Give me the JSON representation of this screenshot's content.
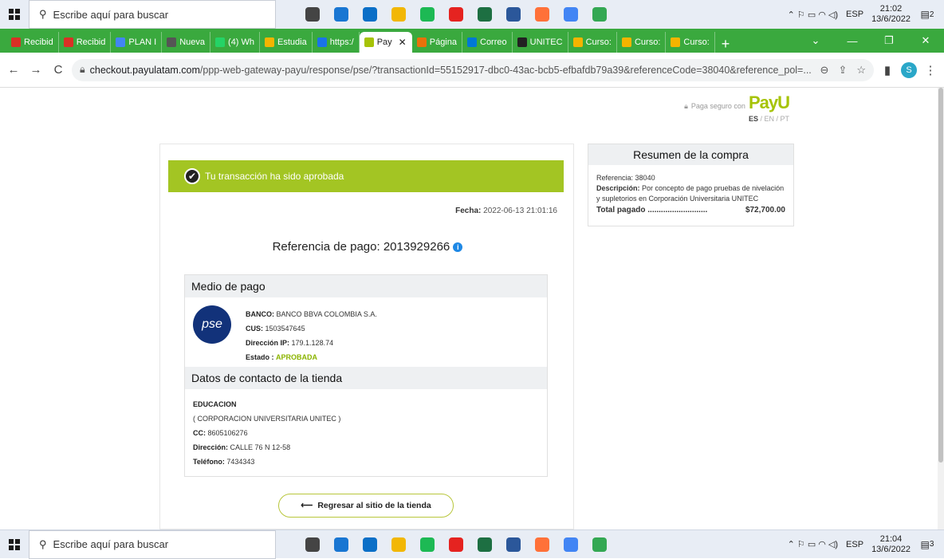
{
  "taskbar": {
    "search_placeholder": "Escribe aquí para buscar",
    "lang": "ESP",
    "top_time": "21:02",
    "top_date": "13/6/2022",
    "top_notif": "2",
    "bottom_time": "21:04",
    "bottom_date": "13/6/2022",
    "bottom_notif": "3",
    "apps": [
      {
        "name": "task-view",
        "color": "#444"
      },
      {
        "name": "edge",
        "color": "#1976d2"
      },
      {
        "name": "mail",
        "color": "#0b6fc7"
      },
      {
        "name": "file-explorer",
        "color": "#f2b705"
      },
      {
        "name": "spotify",
        "color": "#1db954"
      },
      {
        "name": "acrobat",
        "color": "#e52320"
      },
      {
        "name": "excel",
        "color": "#1d6f42"
      },
      {
        "name": "word",
        "color": "#2b579a"
      },
      {
        "name": "firefox",
        "color": "#ff7139"
      },
      {
        "name": "chrome",
        "color": "#4285f4"
      },
      {
        "name": "chrome-alt",
        "color": "#34a853"
      }
    ]
  },
  "tabs": [
    {
      "label": "Recibid",
      "color": "#d93025"
    },
    {
      "label": "Recibid",
      "color": "#d93025"
    },
    {
      "label": "PLAN I",
      "color": "#4285f4"
    },
    {
      "label": "Nueva",
      "color": "#555"
    },
    {
      "label": "(4) Wh",
      "color": "#25d366"
    },
    {
      "label": "Estudia",
      "color": "#f4b400"
    },
    {
      "label": "https:/",
      "color": "#1a73e8"
    },
    {
      "label": "Pay",
      "color": "#a6c307",
      "active": true
    },
    {
      "label": "Página",
      "color": "#e8710a"
    },
    {
      "label": "Correo",
      "color": "#0078d4"
    },
    {
      "label": "UNITEC",
      "color": "#222"
    },
    {
      "label": "Curso:",
      "color": "#f4b400"
    },
    {
      "label": "Curso:",
      "color": "#f4b400"
    },
    {
      "label": "Curso:",
      "color": "#f4b400"
    }
  ],
  "address": {
    "domain": "checkout.payulatam.com",
    "path": "/ppp-web-gateway-payu/response/pse/?transactionId=55152917-dbc0-43ac-bcb5-efbafdb79a39&referenceCode=38040&reference_pol=..."
  },
  "profile_initial": "S",
  "brand": {
    "secure_text": "Paga seguro con",
    "logo": "PayU",
    "lang_active": "ES",
    "lang_rest": " / EN / PT"
  },
  "status": {
    "message": "Tu transacción ha sido aprobada",
    "date_label": "Fecha:",
    "date_value": "2022-06-13 21:01:16",
    "reference": "Referencia de pago: 2013929266"
  },
  "payment": {
    "title": "Medio de pago",
    "logo_text": "pse",
    "bank_label": "BANCO:",
    "bank": "BANCO BBVA COLOMBIA S.A.",
    "cus_label": "CUS:",
    "cus": "1503547645",
    "ip_label": "Dirección IP:",
    "ip": "179.1.128.74",
    "state_label": "Estado :",
    "state": "APROBADA"
  },
  "store": {
    "title": "Datos de contacto de la tienda",
    "name": "EDUCACION",
    "org": "( CORPORACION UNIVERSITARIA UNITEC )",
    "cc_label": "CC:",
    "cc": "8605106276",
    "address_label": "Dirección:",
    "address": "CALLE 76 N 12-58",
    "phone_label": "Teléfono:",
    "phone": "7434343"
  },
  "back_button": "Regresar al sitio de la tienda",
  "summary": {
    "title": "Resumen de la compra",
    "ref_label": "Referencia:",
    "ref": "38040",
    "desc_label": "Descripción:",
    "desc": "Por concepto de pago pruebas de nivelación y supletorios en Corporación Universitaria UNITEC",
    "total_label": "Total pagado ...........................",
    "total": "$72,700.00"
  }
}
